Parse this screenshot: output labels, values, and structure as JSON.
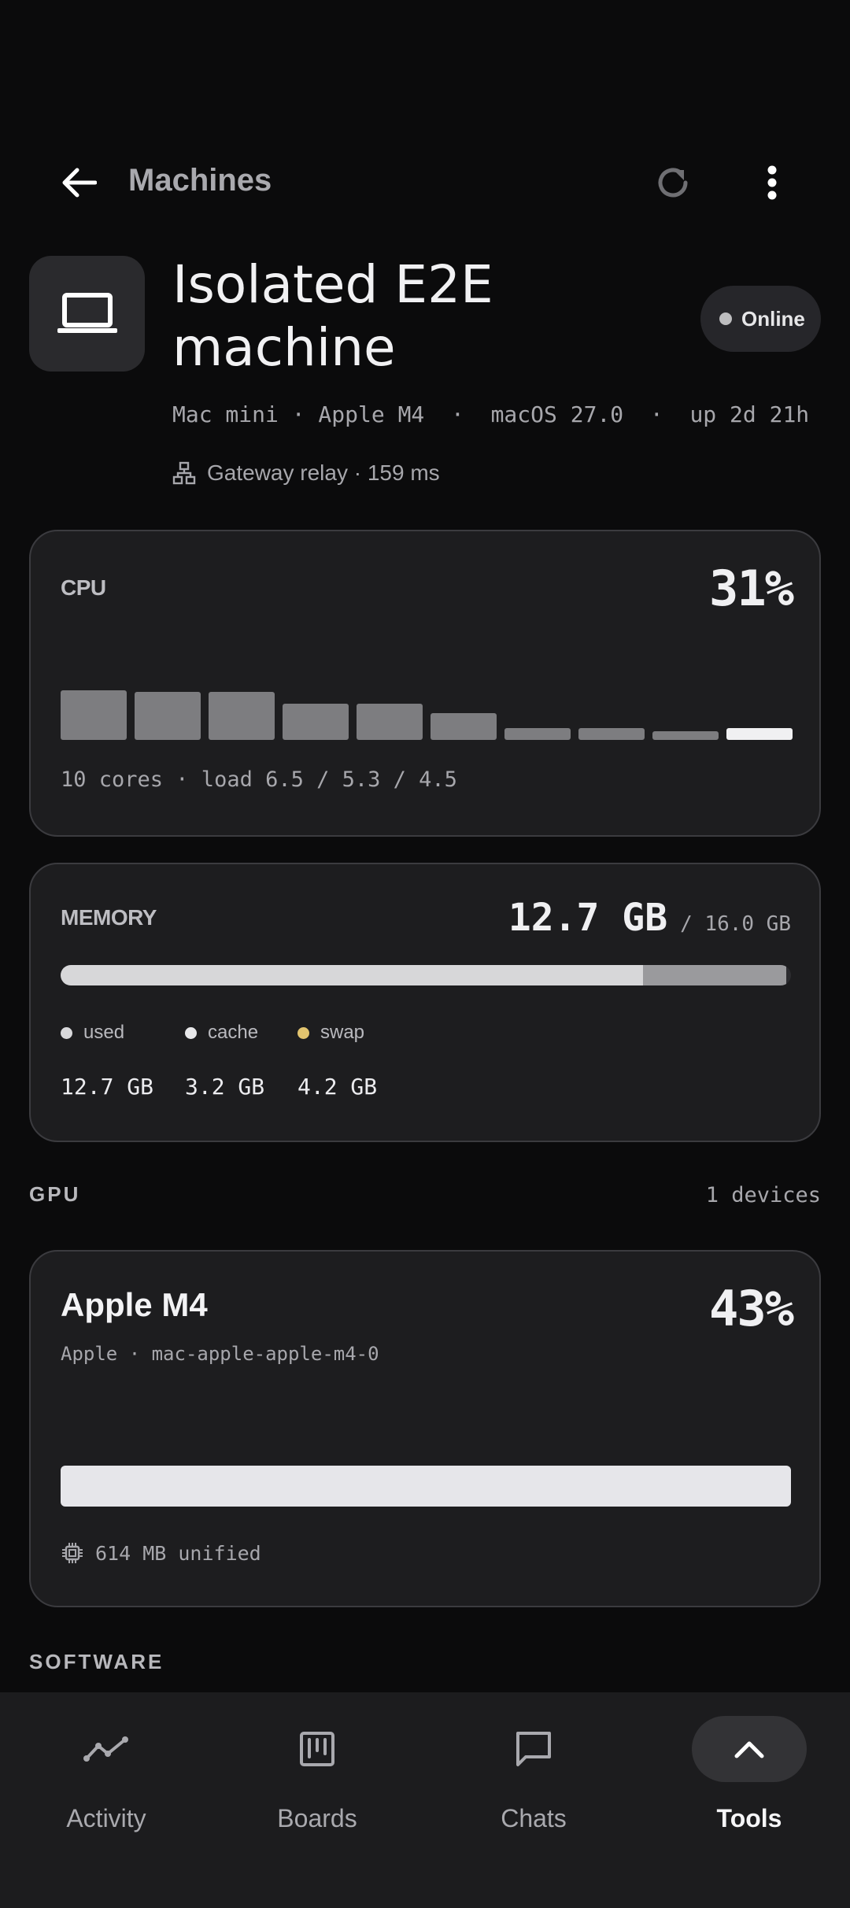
{
  "topbar": {
    "title": "Machines"
  },
  "machine": {
    "name": "Isolated E2E machine",
    "status": "Online",
    "specs": "Mac mini · Apple M4  ·  macOS 27.0  ·  up 2d 21h",
    "relay": "Gateway relay · 159 ms"
  },
  "cpu": {
    "label": "CPU",
    "percent": "31%",
    "core_loads": [
      0.9,
      0.87,
      0.87,
      0.66,
      0.66,
      0.48,
      0.22,
      0.22,
      0.16,
      0.22
    ],
    "hot_core_index": 9,
    "footer": "10 cores · load 6.5 / 5.3 / 4.5"
  },
  "memory": {
    "label": "MEMORY",
    "used": "12.7 GB",
    "total": "/ 16.0 GB",
    "used_fraction": 0.797,
    "cache_fraction": 0.2,
    "legend": [
      {
        "label": "used",
        "value": "12.7 GB",
        "color": "#d9d9db"
      },
      {
        "label": "cache",
        "value": "3.2 GB",
        "color": "#e8e8ea"
      },
      {
        "label": "swap",
        "value": "4.2 GB",
        "color": "#e2c46f"
      }
    ]
  },
  "gpu_section": {
    "title": "GPU",
    "count": "1 devices"
  },
  "gpu": {
    "name": "Apple M4",
    "percent": "43%",
    "subtitle": "Apple · mac-apple-apple-m4-0",
    "fill_fraction": 1.0,
    "memory": "614 MB unified"
  },
  "software_section": {
    "title": "SOFTWARE"
  },
  "nav": [
    {
      "label": "Activity",
      "icon": "activity-icon",
      "active": false
    },
    {
      "label": "Boards",
      "icon": "boards-icon",
      "active": false
    },
    {
      "label": "Chats",
      "icon": "chats-icon",
      "active": false
    },
    {
      "label": "Tools",
      "icon": "chevron-up-icon",
      "active": true
    }
  ]
}
